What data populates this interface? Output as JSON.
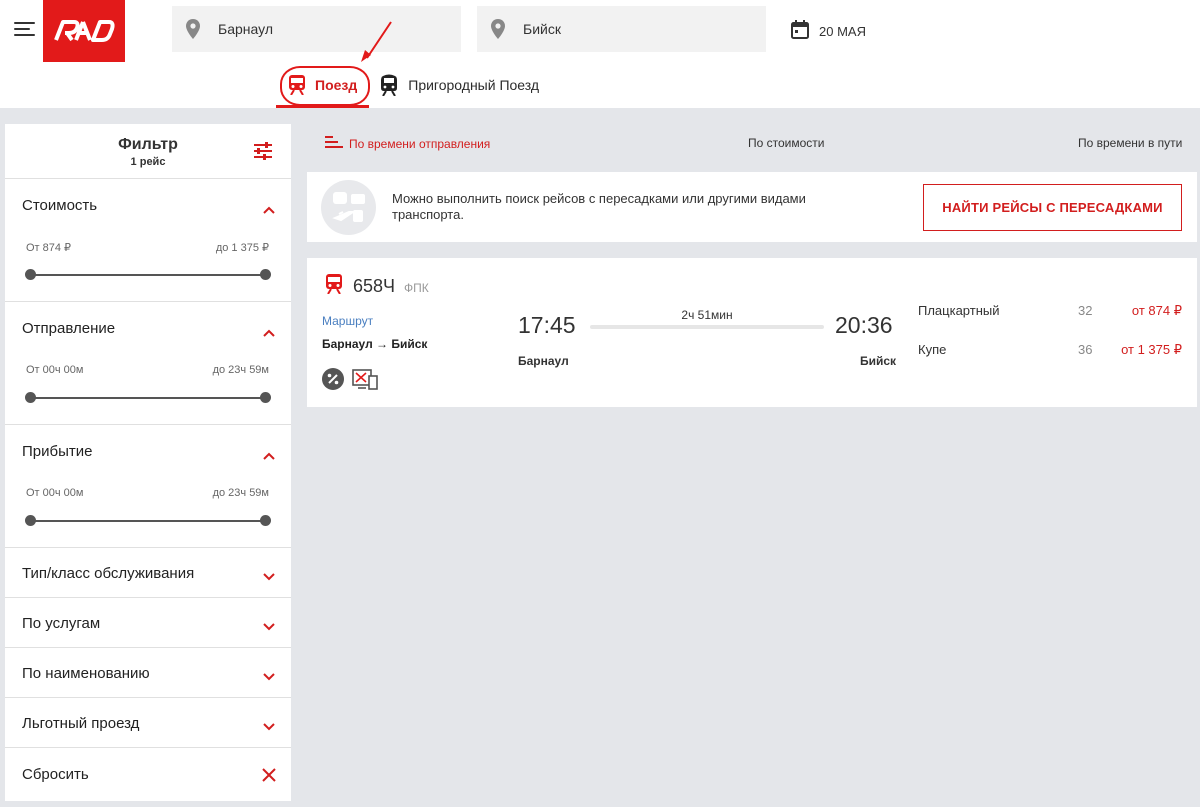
{
  "header": {
    "from": "Барнаул",
    "to": "Бийск",
    "date": "20 МАЯ"
  },
  "tabs": [
    {
      "label": "Поезд",
      "active": true
    },
    {
      "label": "Пригородный Поезд",
      "active": false
    }
  ],
  "filter": {
    "title": "Фильтр",
    "subtitle": "1 рейс",
    "sections": {
      "cost": {
        "label": "Стоимость",
        "min": "От 874 ₽",
        "max": "до 1 375 ₽"
      },
      "departure": {
        "label": "Отправление",
        "min": "От 00ч 00м",
        "max": "до 23ч 59м"
      },
      "arrival": {
        "label": "Прибытие",
        "min": "От 00ч 00м",
        "max": "до 23ч 59м"
      },
      "service_class": {
        "label": "Тип/класс обслуживания"
      },
      "services": {
        "label": "По услугам"
      },
      "name": {
        "label": "По наименованию"
      },
      "privilege": {
        "label": "Льготный проезд"
      }
    },
    "reset": "Сбросить"
  },
  "sort": {
    "by_departure": "По времени отправления",
    "by_cost": "По стоимости",
    "by_duration": "По времени в пути"
  },
  "banner": {
    "text": "Можно выполнить поиск рейсов с пересадками или другими видами транспорта.",
    "button": "НАЙТИ РЕЙСЫ С ПЕРЕСАДКАМИ"
  },
  "trip": {
    "number": "658Ч",
    "carrier": "ФПК",
    "route_link": "Маршрут",
    "route": "Барнаул → Бийск",
    "departure_time": "17:45",
    "arrival_time": "20:36",
    "duration": "2ч 51мин",
    "departure_station": "Барнаул",
    "arrival_station": "Бийск",
    "classes": [
      {
        "name": "Плацкартный",
        "seats": "32",
        "price": "от 874 ₽"
      },
      {
        "name": "Купе",
        "seats": "36",
        "price": "от 1 375 ₽"
      }
    ]
  },
  "colors": {
    "brand": "#e21a1a",
    "link": "#4a7fc0",
    "background": "#e4e6ea"
  }
}
